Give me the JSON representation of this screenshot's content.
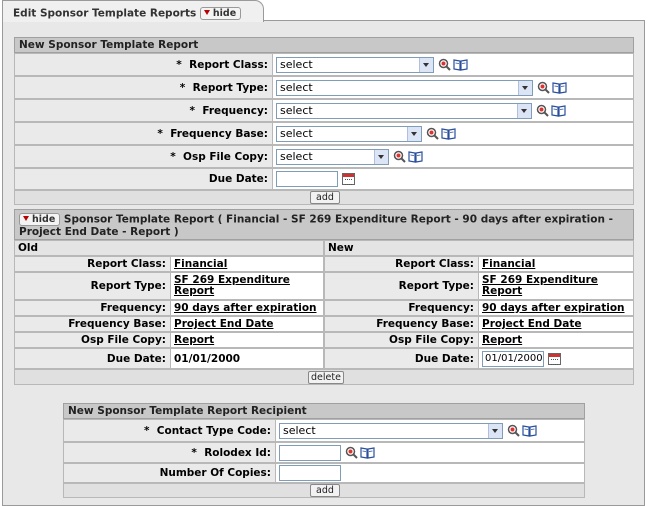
{
  "tab": {
    "title": "Edit Sponsor Template Reports",
    "hide_label": "hide"
  },
  "new_report": {
    "header": "New Sponsor Template Report",
    "fields": [
      {
        "label": "Report Class:",
        "required": true,
        "value": "select"
      },
      {
        "label": "Report Type:",
        "required": true,
        "value": "select"
      },
      {
        "label": "Frequency:",
        "required": true,
        "value": "select"
      },
      {
        "label": "Frequency Base:",
        "required": true,
        "value": "select"
      },
      {
        "label": "Osp File Copy:",
        "required": true,
        "value": "select"
      }
    ],
    "due_date_label": "Due Date:",
    "due_date_value": "",
    "add_label": "add"
  },
  "report": {
    "hide_label": "hide",
    "title": "Sponsor Template Report ( Financial - SF 269 Expenditure Report - 90 days after expiration - Project End Date - Report )",
    "col_old": "Old",
    "col_new": "New",
    "rows": [
      {
        "label": "Report Class:",
        "old": "Financial",
        "new": "Financial"
      },
      {
        "label": "Report Type:",
        "old_line1": "SF 269 Expenditure",
        "old_line2": "Report",
        "new_line1": "SF 269 Expenditure",
        "new_line2": "Report"
      },
      {
        "label": "Frequency:",
        "old": "90 days after expiration",
        "new": "90 days after expiration"
      },
      {
        "label": "Frequency Base:",
        "old": "Project End Date",
        "new": "Project End Date"
      },
      {
        "label": "Osp File Copy:",
        "old": "Report",
        "new": "Report"
      },
      {
        "label": "Due Date:",
        "old": "01/01/2000",
        "new": "01/01/2000"
      }
    ],
    "delete_label": "delete"
  },
  "recipient": {
    "header": "New Sponsor Template Report Recipient",
    "contact_label": "Contact Type Code:",
    "contact_value": "select",
    "rolodex_label": "Rolodex Id:",
    "copies_label": "Number Of Copies:",
    "add_label": "add"
  },
  "required_marker": "*"
}
